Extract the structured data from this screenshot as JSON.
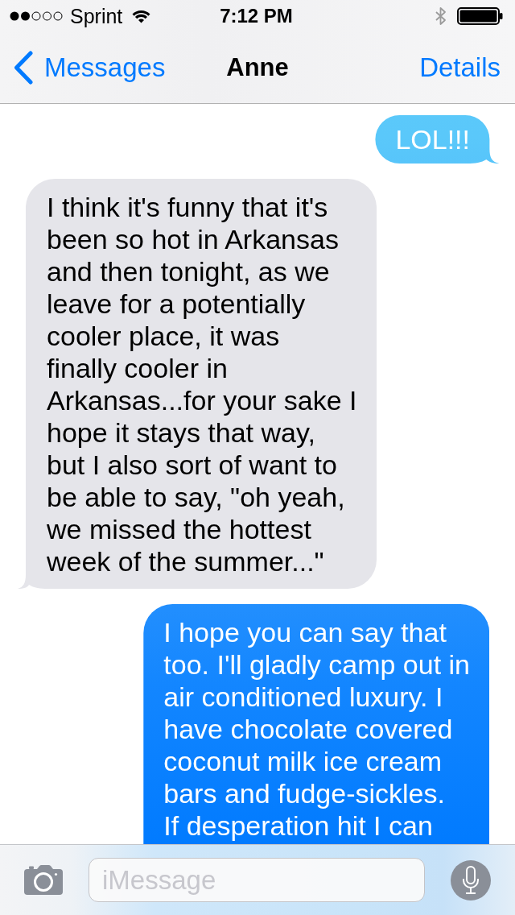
{
  "status_bar": {
    "carrier": "Sprint",
    "time": "7:12 PM"
  },
  "nav_bar": {
    "back_button": "Messages",
    "title": "Anne",
    "details_button": "Details"
  },
  "messages": [
    {
      "kind": "sent",
      "text": "LOL!!!",
      "tail": true
    },
    {
      "kind": "received",
      "text": "I think it's funny that it's\nbeen so hot in Arkansas\nand then tonight, as we\nleave for a potentially\ncooler place, it was\nfinally cooler in\nArkansas...for your sake I\nhope it stays that way,\nbut I also sort of want to\nbe able to say, \"oh yeah,\nwe missed the hottest\nweek of the summer...\"",
      "tail": true
    },
    {
      "kind": "sent",
      "text": "I hope you can say that\ntoo. I'll gladly camp out in\nair conditioned luxury. I\nhave chocolate covered\ncoconut milk ice cream\nbars and fudge-sickles.\nIf desperation hit I can",
      "tail": false
    }
  ],
  "compose_bar": {
    "placeholder": "iMessage"
  }
}
